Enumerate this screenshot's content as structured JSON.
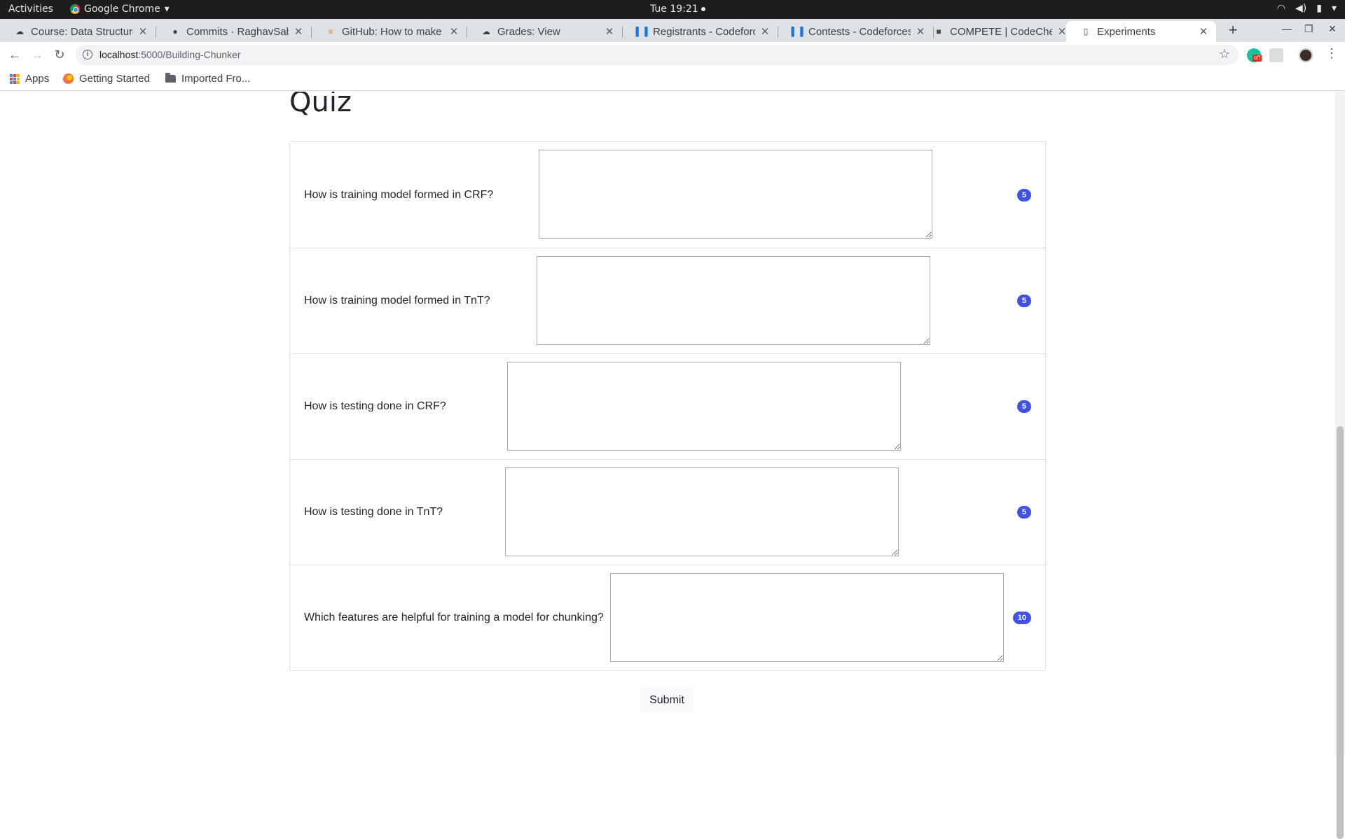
{
  "system": {
    "activities": "Activities",
    "app_name": "Google Chrome",
    "clock": "Tue 19:21"
  },
  "tabs": [
    {
      "title": "Course: Data Structure",
      "icon": "cloud-icon"
    },
    {
      "title": "Commits · RaghavSab",
      "icon": "github-icon"
    },
    {
      "title": "GitHub: How to make",
      "icon": "stackoverflow-icon"
    },
    {
      "title": "Grades: View",
      "icon": "cloud-icon"
    },
    {
      "title": "Registrants - Codeforc",
      "icon": "codeforces-icon"
    },
    {
      "title": "Contests - Codeforces",
      "icon": "codeforces-icon"
    },
    {
      "title": "COMPETE | CodeChef",
      "icon": "codechef-icon"
    },
    {
      "title": "Experiments",
      "icon": "page-icon",
      "active": true
    }
  ],
  "address": {
    "host": "localhost",
    "path": ":5000/Building-Chunker"
  },
  "bookmarks": {
    "apps": "Apps",
    "getting_started": "Getting Started",
    "imported": "Imported Fro..."
  },
  "page": {
    "title": "Quiz",
    "questions": [
      {
        "text": "How is training model formed in CRF?",
        "answer": "",
        "points": "5"
      },
      {
        "text": "How is training model formed in TnT?",
        "answer": "",
        "points": "5"
      },
      {
        "text": "How is testing done in CRF?",
        "answer": "",
        "points": "5"
      },
      {
        "text": "How is testing done in TnT?",
        "answer": "",
        "points": "5"
      },
      {
        "text": "Which features are helpful for training a model for chunking?",
        "answer": "",
        "points": "10"
      }
    ],
    "submit_label": "Submit"
  },
  "colors": {
    "badge": "#3f51e6",
    "tabstrip": "#dee1e6"
  }
}
